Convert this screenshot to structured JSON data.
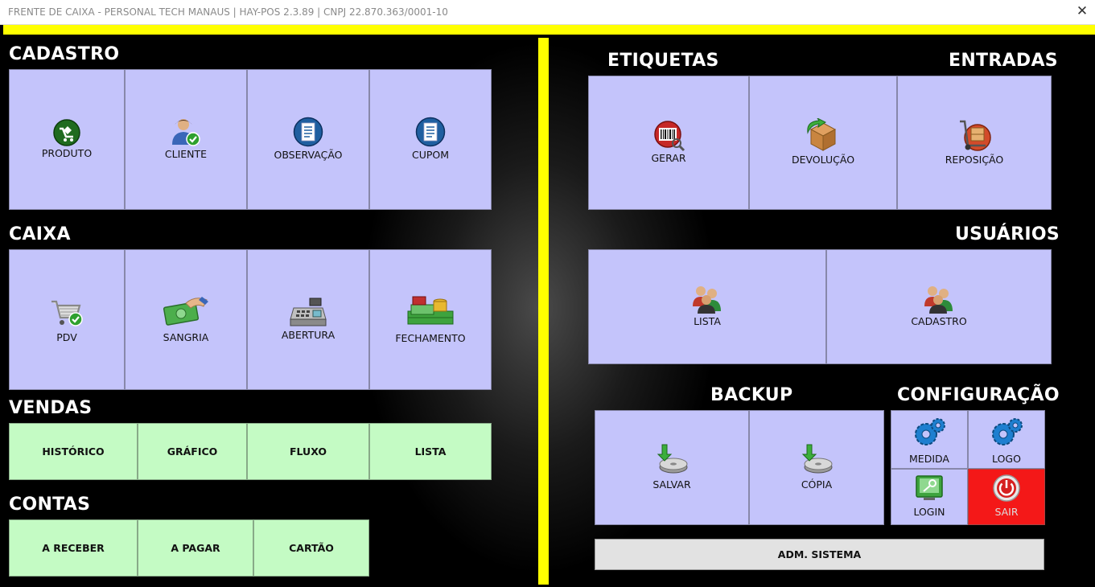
{
  "window": {
    "title": "FRENTE DE CAIXA - PERSONAL TECH MANAUS | HAY-POS 2.3.89 | CNPJ 22.870.363/0001-10",
    "close_glyph": "✕"
  },
  "cadastro": {
    "heading": "CADASTRO",
    "items": [
      {
        "label": "PRODUTO",
        "icon": "product-icon"
      },
      {
        "label": "CLIENTE",
        "icon": "client-icon"
      },
      {
        "label": "OBSERVAÇÃO",
        "icon": "document-icon"
      },
      {
        "label": "CUPOM",
        "icon": "document-icon"
      }
    ]
  },
  "caixa": {
    "heading": "CAIXA",
    "items": [
      {
        "label": "PDV",
        "icon": "cart-icon"
      },
      {
        "label": "SANGRIA",
        "icon": "money-icon"
      },
      {
        "label": "ABERTURA",
        "icon": "cash-register-icon"
      },
      {
        "label": "FECHAMENTO",
        "icon": "cash-stack-icon"
      }
    ]
  },
  "vendas": {
    "heading": "VENDAS",
    "items": [
      {
        "label": "HISTÓRICO"
      },
      {
        "label": "GRÁFICO"
      },
      {
        "label": "FLUXO"
      },
      {
        "label": "LISTA"
      }
    ]
  },
  "contas": {
    "heading": "CONTAS",
    "items": [
      {
        "label": "A RECEBER"
      },
      {
        "label": "A PAGAR"
      },
      {
        "label": "CARTÃO"
      }
    ]
  },
  "etiquetas": {
    "heading": "ETIQUETAS",
    "items": [
      {
        "label": "GERAR",
        "icon": "barcode-icon"
      }
    ]
  },
  "entradas": {
    "heading": "ENTRADAS",
    "items": [
      {
        "label": "DEVOLUÇÃO",
        "icon": "box-return-icon"
      },
      {
        "label": "REPOSIÇÃO",
        "icon": "hand-truck-icon"
      }
    ]
  },
  "usuarios": {
    "heading": "USUÁRIOS",
    "items": [
      {
        "label": "LISTA",
        "icon": "users-icon"
      },
      {
        "label": "CADASTRO",
        "icon": "users-icon"
      }
    ]
  },
  "backup": {
    "heading": "BACKUP",
    "items": [
      {
        "label": "SALVAR",
        "icon": "disk-download-icon"
      },
      {
        "label": "CÓPIA",
        "icon": "disk-download-icon"
      }
    ]
  },
  "configuracao": {
    "heading": "CONFIGURAÇÃO",
    "items": [
      {
        "label": "MEDIDA",
        "icon": "gears-icon"
      },
      {
        "label": "LOGO",
        "icon": "gears-icon"
      },
      {
        "label": "LOGIN",
        "icon": "login-key-icon"
      },
      {
        "label": "SAIR",
        "icon": "power-icon"
      }
    ]
  },
  "adm": {
    "label": "ADM. SISTEMA"
  },
  "colors": {
    "accent_yellow": "#ffff00",
    "tile_lavender": "#c4c4fb",
    "tile_green": "#c4fbc4",
    "exit_red": "#f41818",
    "background": "#000000"
  }
}
